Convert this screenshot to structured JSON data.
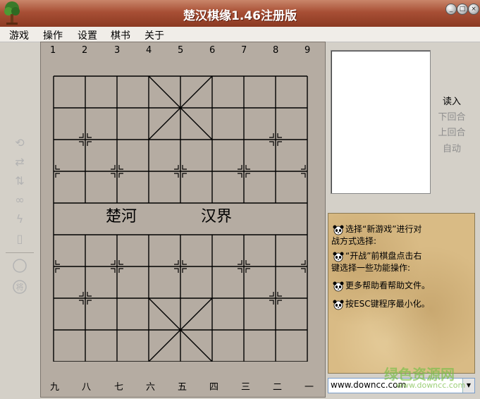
{
  "window": {
    "title": "楚汉棋缘1.46注册版",
    "controls": [
      "minimize",
      "maximize",
      "close"
    ]
  },
  "menu": [
    {
      "label": "游戏"
    },
    {
      "label": "操作"
    },
    {
      "label": "设置"
    },
    {
      "label": "棋书"
    },
    {
      "label": "关于"
    }
  ],
  "toolbar_icons": [
    "refresh-icon",
    "swap-horizontal-icon",
    "swap-vertical-icon",
    "link-icon",
    "lightning-icon",
    "door-icon",
    "circle-icon",
    "general-piece-icon"
  ],
  "board": {
    "top_coords": [
      "1",
      "2",
      "3",
      "4",
      "5",
      "6",
      "7",
      "8",
      "9"
    ],
    "bottom_coords": [
      "九",
      "八",
      "七",
      "六",
      "五",
      "四",
      "三",
      "二",
      "一"
    ],
    "river_left": "楚河",
    "river_right": "汉界"
  },
  "right_panel": {
    "buttons": [
      {
        "label": "读入",
        "enabled": true
      },
      {
        "label": "下回合",
        "enabled": false
      },
      {
        "label": "上回合",
        "enabled": false
      },
      {
        "label": "自动",
        "enabled": false
      }
    ],
    "tips": [
      {
        "line1": "选择“新游戏”进行对",
        "line2": "战方式选择:"
      },
      {
        "line1": "“开战”前棋盘点击右",
        "line2": "键选择一些功能操作:"
      },
      {
        "line1": "更多帮助看帮助文件。",
        "line2": ""
      },
      {
        "line1": "按ESC键程序最小化。",
        "line2": ""
      }
    ],
    "address": "www.downcc.com"
  },
  "watermark": {
    "title": "绿色资源网",
    "url": "www.downcc.com"
  }
}
